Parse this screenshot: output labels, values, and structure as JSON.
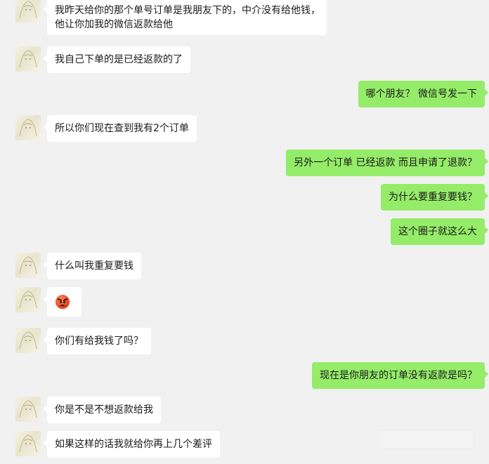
{
  "messages": [
    {
      "side": "in",
      "lines": [
        "我昨天给你的那个单号订单是我朋友下的，中介没有给他钱，",
        "他让你加我的微信返款给他"
      ]
    },
    {
      "side": "in",
      "lines": [
        "我自己下单的是已经返款的了"
      ]
    },
    {
      "side": "out",
      "lines": [
        "哪个朋友？ 微信号发一下"
      ]
    },
    {
      "side": "in",
      "lines": [
        "所以你们现在查到我有2个订单"
      ]
    },
    {
      "side": "out",
      "lines": [
        "另外一个订单 已经返款 而且申请了退款？"
      ]
    },
    {
      "side": "out",
      "lines": [
        "为什么要重复要钱？"
      ]
    },
    {
      "side": "out",
      "lines": [
        "这个圈子就这么大"
      ]
    },
    {
      "side": "in",
      "lines": [
        "什么叫我重复要钱"
      ]
    },
    {
      "side": "in",
      "emoji": "angry-face-emoji"
    },
    {
      "side": "in",
      "lines": [
        "你们有给我钱了吗？"
      ]
    },
    {
      "side": "out",
      "lines": [
        "现在是你朋友的订单没有返款是吗？"
      ]
    },
    {
      "side": "in",
      "lines": [
        "你是不是不想返款给我"
      ]
    },
    {
      "side": "in",
      "lines": [
        "如果这样的话我就给你再上几个差评"
      ]
    }
  ],
  "colors": {
    "background": "#f1f1f1",
    "incoming_bubble": "#ffffff",
    "outgoing_bubble": "#95ec69"
  }
}
